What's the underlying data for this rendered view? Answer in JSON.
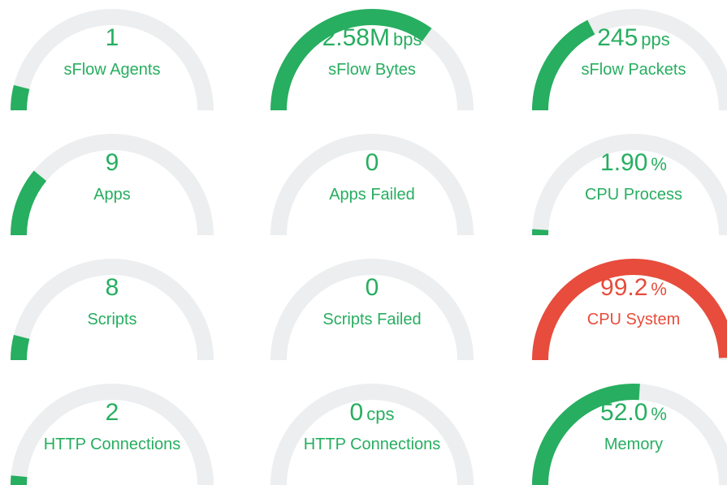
{
  "colors": {
    "ok": "#27ae60",
    "alert": "#e74c3c",
    "track": "#eceeef"
  },
  "gauges": [
    {
      "value": "1",
      "unit": "",
      "label": "sFlow Agents",
      "fraction": 0.08,
      "status": "ok"
    },
    {
      "value": "2.58M",
      "unit": "bps",
      "label": "sFlow Bytes",
      "fraction": 0.7,
      "status": "ok"
    },
    {
      "value": "245",
      "unit": "pps",
      "label": "sFlow Packets",
      "fraction": 0.35,
      "status": "ok"
    },
    {
      "value": "9",
      "unit": "",
      "label": "Apps",
      "fraction": 0.22,
      "status": "ok"
    },
    {
      "value": "0",
      "unit": "",
      "label": "Apps Failed",
      "fraction": 0.0,
      "status": "ok"
    },
    {
      "value": "1.90",
      "unit": "%",
      "label": "CPU Process",
      "fraction": 0.019,
      "status": "ok"
    },
    {
      "value": "8",
      "unit": "",
      "label": "Scripts",
      "fraction": 0.08,
      "status": "ok"
    },
    {
      "value": "0",
      "unit": "",
      "label": "Scripts Failed",
      "fraction": 0.0,
      "status": "ok"
    },
    {
      "value": "99.2",
      "unit": "%",
      "label": "CPU System",
      "fraction": 0.992,
      "status": "alert"
    },
    {
      "value": "2",
      "unit": "",
      "label": "HTTP Connections",
      "fraction": 0.03,
      "status": "ok"
    },
    {
      "value": "0",
      "unit": "cps",
      "label": "HTTP Connections",
      "fraction": 0.0,
      "status": "ok"
    },
    {
      "value": "52.0",
      "unit": "%",
      "label": "Memory",
      "fraction": 0.52,
      "status": "ok"
    }
  ]
}
